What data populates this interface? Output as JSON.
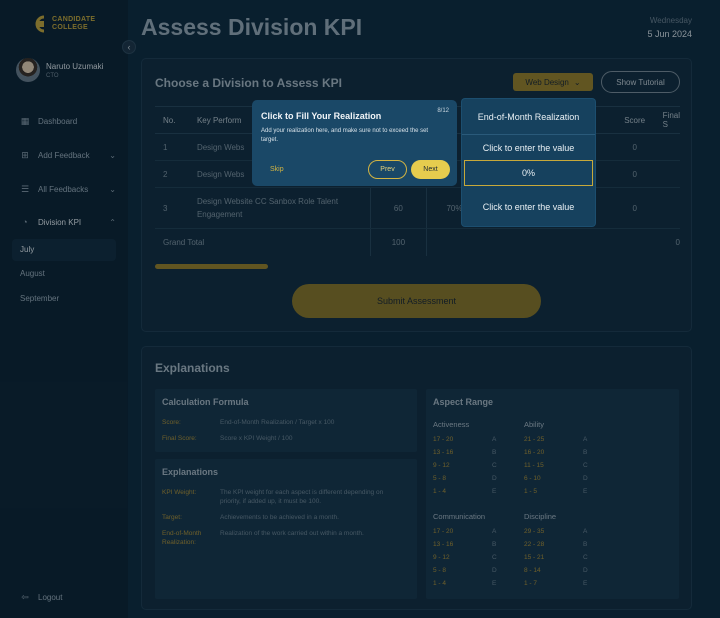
{
  "brand": {
    "line1": "CANDIDATE",
    "line2": "COLLEGE"
  },
  "user": {
    "name": "Naruto Uzumaki",
    "role": "CTO"
  },
  "nav": {
    "dashboard": "Dashboard",
    "add_feedback": "Add Feedback",
    "all_feedbacks": "All Feedbacks",
    "division_kpi": "Division KPI",
    "sub": [
      "July",
      "August",
      "September"
    ],
    "logout": "Logout"
  },
  "header": {
    "title": "Assess Division KPI",
    "weekday": "Wednesday",
    "date": "5 Jun 2024"
  },
  "assess": {
    "title": "Choose a Division to Assess KPI",
    "division_select": "Web Design",
    "show_tutorial": "Show Tutorial",
    "columns": [
      "No.",
      "Key Perform",
      "End-of-Month Realization",
      "Score",
      "Final S"
    ],
    "rows": [
      {
        "no": "1",
        "kpi": "Design Webs",
        "weight": "",
        "target": "",
        "score": "0"
      },
      {
        "no": "2",
        "kpi": "Design Webs",
        "weight": "",
        "target": "",
        "score": "0"
      },
      {
        "no": "3",
        "kpi": "Design Website CC Sanbox Role Talent Engagement",
        "weight": "60",
        "target": "70%",
        "score": "0"
      }
    ],
    "grand_total_label": "Grand Total",
    "grand_total": "100",
    "grand_total_final": "0",
    "realization_cells": [
      "Click to enter the value",
      "0%",
      "Click to enter the value"
    ],
    "submit": "Submit Assessment"
  },
  "tutorial": {
    "title": "Click to Fill Your Realization",
    "step": "8/12",
    "body": "Add your realization here, and make sure not to exceed the set target.",
    "skip": "Skip",
    "prev": "Prev",
    "next": "Next"
  },
  "explanations": {
    "title": "Explanations",
    "calc": {
      "title": "Calculation Formula",
      "items": [
        {
          "k": "Score:",
          "v": "End-of-Month Realization / Target x 100"
        },
        {
          "k": "Final Score:",
          "v": "Score x KPI Weight / 100"
        }
      ]
    },
    "expl": {
      "title": "Explanations",
      "items": [
        {
          "k": "KPI Weight:",
          "v": "The KPI weight for each aspect is different depending on priority, if added up, it must be 100."
        },
        {
          "k": "Target:",
          "v": "Achievements to be achieved in a month."
        },
        {
          "k": "End-of-Month Realization:",
          "v": "Realization of the work carried out within a month."
        }
      ]
    },
    "range": {
      "title": "Aspect Range",
      "groups": [
        {
          "name": "Activeness",
          "rows": [
            [
              "17 - 20",
              "A"
            ],
            [
              "13 - 16",
              "B"
            ],
            [
              "9 - 12",
              "C"
            ],
            [
              "5 - 8",
              "D"
            ],
            [
              "1 - 4",
              "E"
            ]
          ]
        },
        {
          "name": "Ability",
          "rows": [
            [
              "21 - 25",
              "A"
            ],
            [
              "16 - 20",
              "B"
            ],
            [
              "11 - 15",
              "C"
            ],
            [
              "6 - 10",
              "D"
            ],
            [
              "1 - 5",
              "E"
            ]
          ]
        },
        {
          "name": "Communication",
          "rows": [
            [
              "17 - 20",
              "A"
            ],
            [
              "13 - 16",
              "B"
            ],
            [
              "9 - 12",
              "C"
            ],
            [
              "5 - 8",
              "D"
            ],
            [
              "1 - 4",
              "E"
            ]
          ]
        },
        {
          "name": "Discipline",
          "rows": [
            [
              "29 - 35",
              "A"
            ],
            [
              "22 - 28",
              "B"
            ],
            [
              "15 - 21",
              "C"
            ],
            [
              "8 - 14",
              "D"
            ],
            [
              "1 - 7",
              "E"
            ]
          ]
        }
      ]
    }
  },
  "colors": {
    "accent": "#c7a93a",
    "background": "#0e2a3e",
    "sidebar": "#0c2333",
    "highlight": "#16415e"
  }
}
